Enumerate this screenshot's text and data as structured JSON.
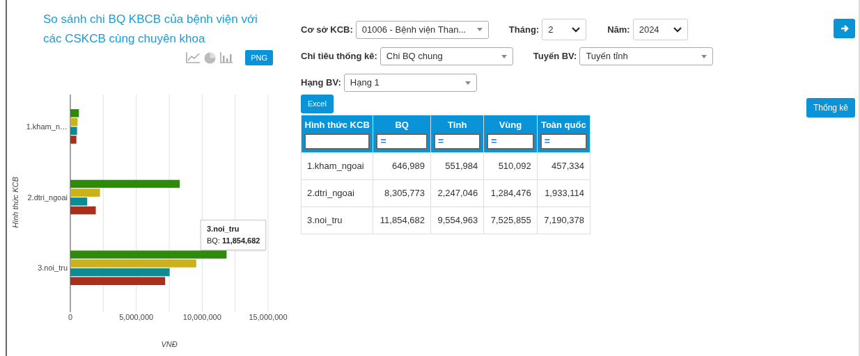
{
  "chart_panel": {
    "title": "So sánh chi BQ KBCB của bệnh viện với các CSKCB cùng chuyên khoa",
    "png_button": "PNG",
    "chart_data": {
      "type": "bar",
      "orientation": "horizontal",
      "ylabel": "Hình thức KCB",
      "xlabel": "VNĐ",
      "categories": [
        "1.kham_n…",
        "2.dtri_ngoai",
        "3.noi_tru"
      ],
      "series": [
        {
          "color": "#2e8b0a",
          "values": [
            650000,
            8300000,
            11850000
          ]
        },
        {
          "color": "#cbb11a",
          "values": [
            550000,
            2250000,
            9550000
          ]
        },
        {
          "color": "#0e8a92",
          "values": [
            510000,
            1280000,
            7530000
          ]
        },
        {
          "color": "#a8301a",
          "values": [
            460000,
            1930000,
            7190000
          ]
        }
      ],
      "xlim": [
        0,
        15000000
      ],
      "xticks": [
        {
          "value": 0,
          "label": "0"
        },
        {
          "value": 5000000,
          "label": "5,000,000"
        },
        {
          "value": 10000000,
          "label": "10,000,000"
        },
        {
          "value": 15000000,
          "label": "15,000,000"
        }
      ]
    },
    "tooltip": {
      "title": "3.noi_tru",
      "text": "BQ: **11,854,682**"
    }
  },
  "filters": [
    {
      "label": "Cơ sở KCB:",
      "value": "01006 - Bệnh viện Than...",
      "kind": "combo"
    },
    {
      "label": "Tháng:",
      "value": "2",
      "kind": "native"
    },
    {
      "label": "Năm:",
      "value": "2024",
      "kind": "native"
    },
    {
      "label": "Chỉ tiêu thống kê:",
      "value": "Chi BQ chung",
      "kind": "combo"
    },
    {
      "label": "Tuyến BV:",
      "value": "Tuyến tỉnh",
      "kind": "combo"
    },
    {
      "label": "Hạng BV:",
      "value": "Hạng 1",
      "kind": "combo"
    }
  ],
  "excel_button": "Excel",
  "stats_button": "Thống kê",
  "table": {
    "columns": [
      {
        "label": "Hình thức KCB"
      },
      {
        "label": "BQ",
        "filter_placeholder": "="
      },
      {
        "label": "Tỉnh",
        "filter_placeholder": "="
      },
      {
        "label": "Vùng",
        "filter_placeholder": "="
      },
      {
        "label": "Toàn quốc",
        "filter_placeholder": "="
      }
    ],
    "rows": [
      [
        "1.kham_ngoai",
        "646,989",
        "551,984",
        "510,092",
        "457,334"
      ],
      [
        "2.dtri_ngoai",
        "8,305,773",
        "2,247,046",
        "1,284,476",
        "1,933,114"
      ],
      [
        "3.noi_tru",
        "11,854,682",
        "9,554,963",
        "7,525,855",
        "7,190,378"
      ]
    ]
  }
}
